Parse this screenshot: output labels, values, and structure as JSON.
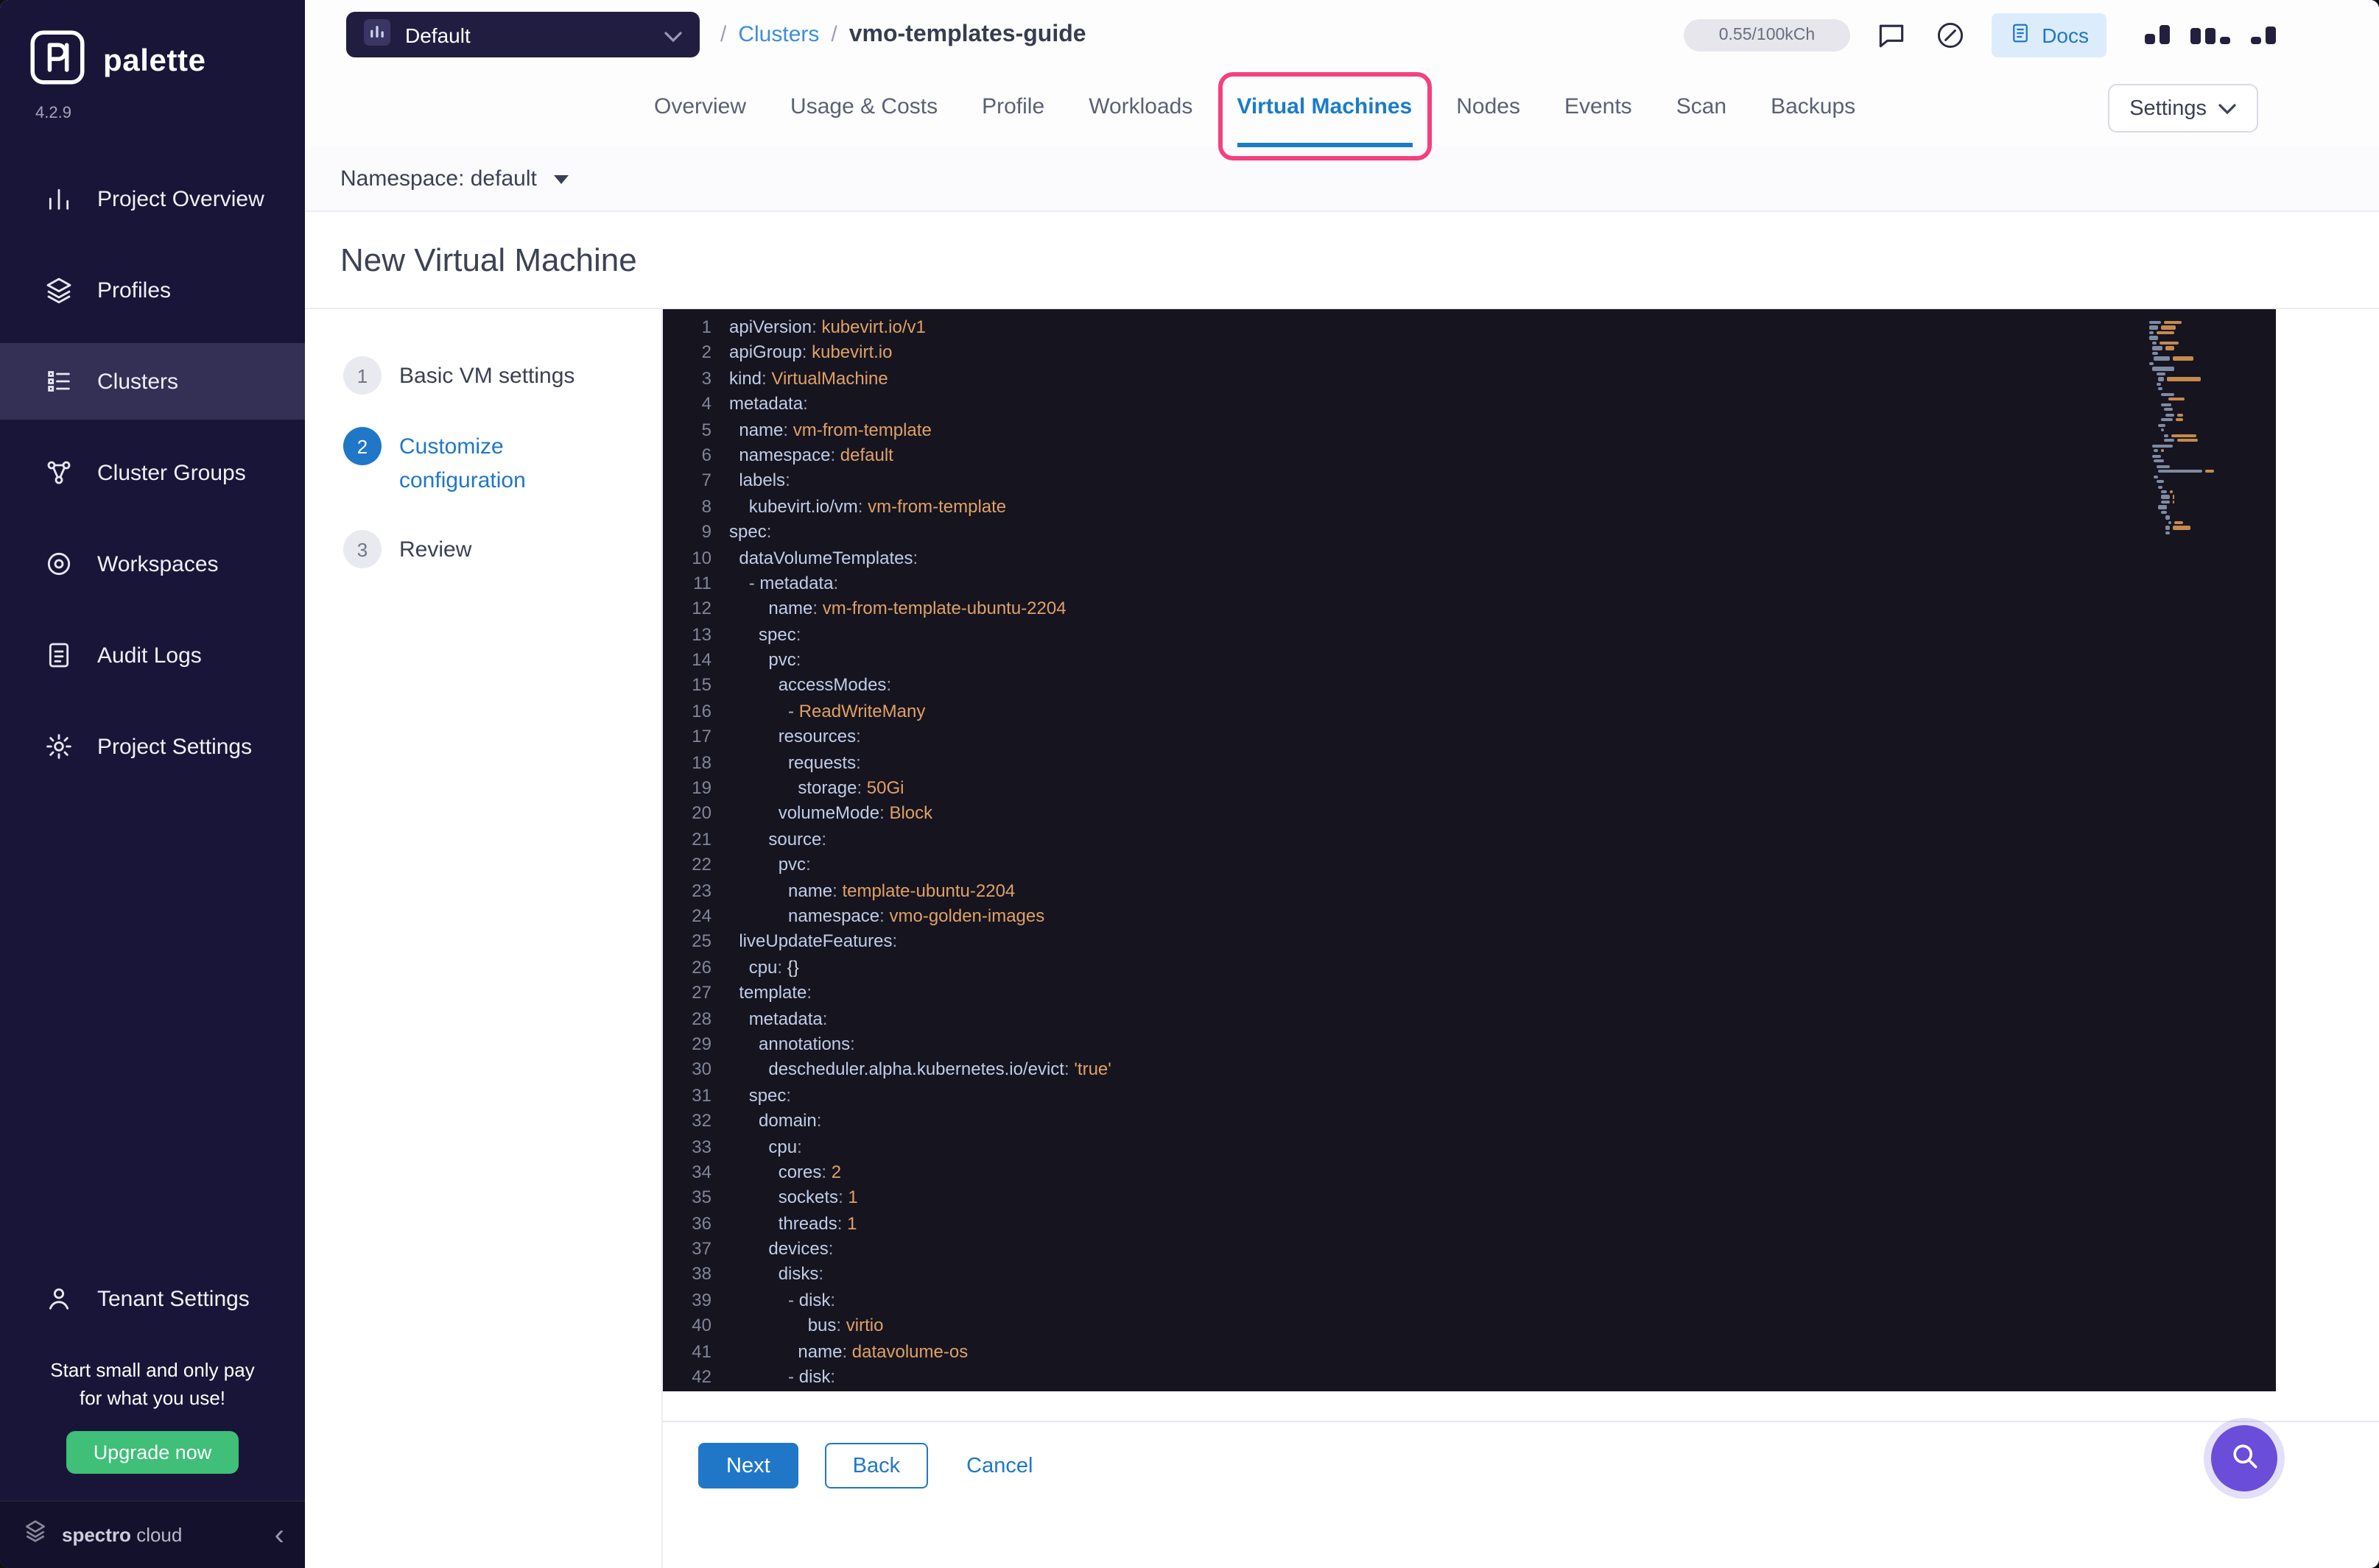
{
  "colors": {
    "accent_blue": "#2077c8",
    "annotation_pink": "#f4407d",
    "upgrade_green": "#3fbf77",
    "fab_purple": "#6a4dd8",
    "sidebar_bg": "#191538",
    "editor_bg": "#16141f",
    "yaml_key": "#c0cde8",
    "yaml_value": "#e0a165"
  },
  "sidebar": {
    "brand": "palette",
    "version": "4.2.9",
    "items": [
      {
        "label": "Project Overview",
        "icon": "bar-chart-icon",
        "active": false
      },
      {
        "label": "Profiles",
        "icon": "layers-icon",
        "active": false
      },
      {
        "label": "Clusters",
        "icon": "clusters-icon",
        "active": true
      },
      {
        "label": "Cluster Groups",
        "icon": "cluster-groups-icon",
        "active": false
      },
      {
        "label": "Workspaces",
        "icon": "workspaces-icon",
        "active": false
      },
      {
        "label": "Audit Logs",
        "icon": "audit-logs-icon",
        "active": false
      },
      {
        "label": "Project Settings",
        "icon": "gear-icon",
        "active": false
      }
    ],
    "tenant_settings": {
      "label": "Tenant Settings",
      "icon": "person-icon"
    },
    "promo_line1": "Start small and only pay",
    "promo_line2": "for what you use!",
    "upgrade_label": "Upgrade now",
    "footer_brand_1": "spectro",
    "footer_brand_2": "cloud"
  },
  "header": {
    "project_selector": "Default",
    "breadcrumb_sep1": "/",
    "breadcrumb_parent": "Clusters",
    "breadcrumb_sep2": "/",
    "breadcrumb_current": "vmo-templates-guide",
    "usage": "0.55/100kCh",
    "docs_label": "Docs"
  },
  "tabs": [
    "Overview",
    "Usage & Costs",
    "Profile",
    "Workloads",
    "Virtual Machines",
    "Nodes",
    "Events",
    "Scan",
    "Backups"
  ],
  "active_tab": "Virtual Machines",
  "settings_button": "Settings",
  "namespace_label": "Namespace: default",
  "page_title": "New Virtual Machine",
  "stepper": [
    {
      "num": "1",
      "label": "Basic VM settings",
      "active": false
    },
    {
      "num": "2",
      "label": "Customize configuration",
      "active": true
    },
    {
      "num": "3",
      "label": "Review",
      "active": false
    }
  ],
  "editor": {
    "lines": [
      "apiVersion: kubevirt.io/v1",
      "apiGroup: kubevirt.io",
      "kind: VirtualMachine",
      "metadata:",
      "  name: vm-from-template",
      "  namespace: default",
      "  labels:",
      "    kubevirt.io/vm: vm-from-template",
      "spec:",
      "  dataVolumeTemplates:",
      "    - metadata:",
      "        name: vm-from-template-ubuntu-2204",
      "      spec:",
      "        pvc:",
      "          accessModes:",
      "            - ReadWriteMany",
      "          resources:",
      "            requests:",
      "              storage: 50Gi",
      "          volumeMode: Block",
      "        source:",
      "          pvc:",
      "            name: template-ubuntu-2204",
      "            namespace: vmo-golden-images",
      "  liveUpdateFeatures:",
      "    cpu: {}",
      "  template:",
      "    metadata:",
      "      annotations:",
      "        descheduler.alpha.kubernetes.io/evict: 'true'",
      "    spec:",
      "      domain:",
      "        cpu:",
      "          cores: 2",
      "          sockets: 1",
      "          threads: 1",
      "        devices:",
      "          disks:",
      "            - disk:",
      "                bus: virtio",
      "              name: datavolume-os",
      "            - disk:"
    ]
  },
  "wizard_footer": {
    "next": "Next",
    "back": "Back",
    "cancel": "Cancel"
  }
}
